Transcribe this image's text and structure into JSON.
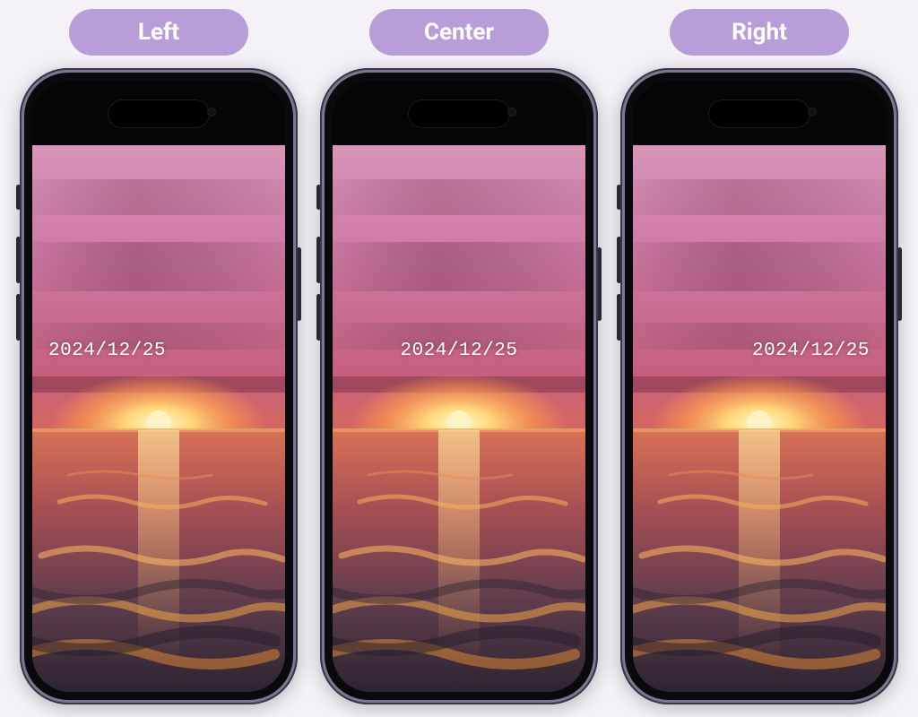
{
  "colors": {
    "page_bg": "#f4f2f7",
    "pill_bg": "#b79ed9",
    "pill_fg": "#ffffff",
    "frame_edge_outer": "#7f7791",
    "frame_edge_inner": "#3b3544",
    "date_text": "#ffffff"
  },
  "options": [
    {
      "key": "left",
      "label": "Left",
      "date": "2024/12/25",
      "align": "left"
    },
    {
      "key": "center",
      "label": "Center",
      "date": "2024/12/25",
      "align": "center"
    },
    {
      "key": "right",
      "label": "Right",
      "date": "2024/12/25",
      "align": "right"
    }
  ]
}
